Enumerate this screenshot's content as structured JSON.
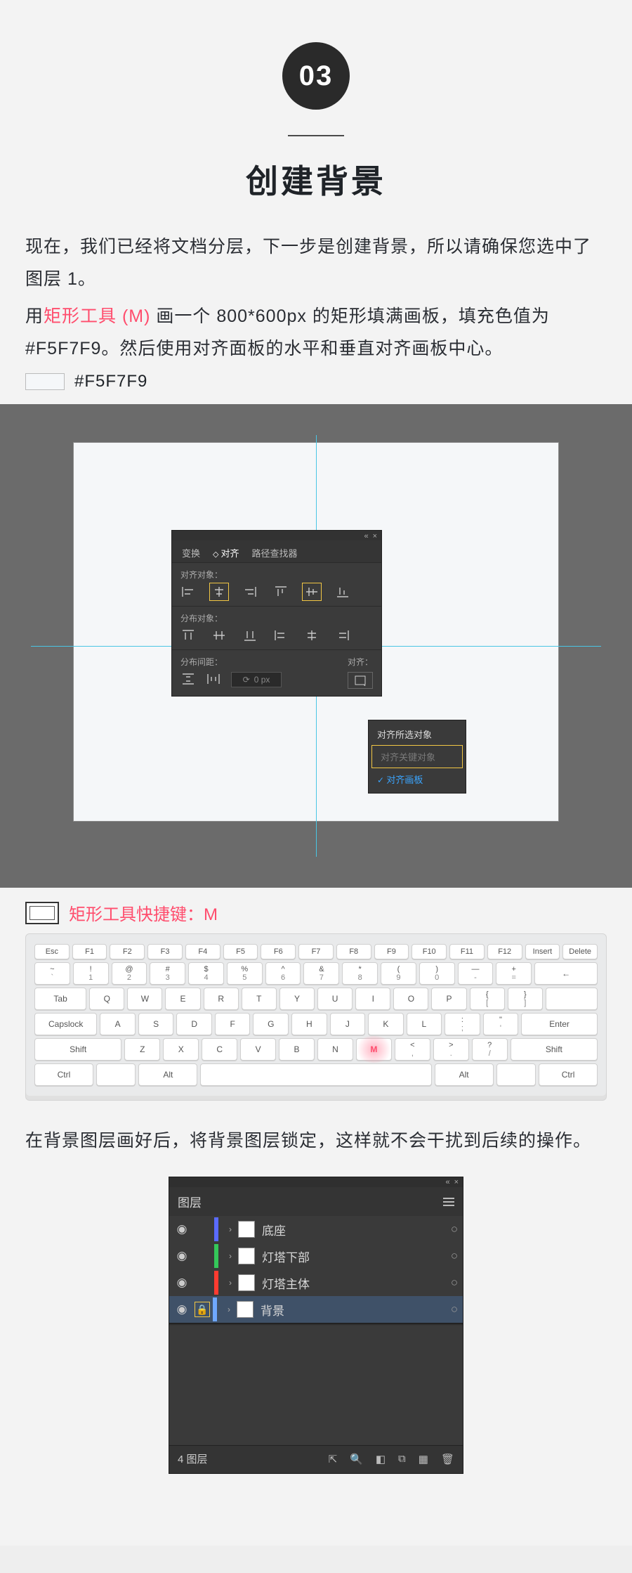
{
  "section": {
    "number": "03",
    "title": "创建背景",
    "intro_before": "现在，我们已经将文档分层，下一步是创建背景，所以请确保您选中了图层 1。",
    "intro2_a": "用",
    "intro2_tool": "矩形工具 (M) ",
    "intro2_b": "画一个 800*600px 的矩形填满画板，填充色值为 #F5F7F9。然后使用对齐面板的水平和垂直对齐画板中心。",
    "swatch_code": "#F5F7F9",
    "shortcut_label": "矩形工具快捷键：M",
    "outro": "在背景图层画好后，将背景图层锁定，这样就不会干扰到后续的操作。",
    "colors": {
      "accent": "#ff4d6d",
      "swatch": "#F5F7F9"
    }
  },
  "align_panel": {
    "tabs": [
      "变换",
      "对齐",
      "路径查找器"
    ],
    "group1": "对齐对象：",
    "group2": "分布对象：",
    "group3": "分布间距：",
    "align_to_label": "对齐：",
    "px_value": "0 px",
    "menu": {
      "opt1": "对齐所选对象",
      "opt2": "对齐关键对象",
      "opt3": "对齐画板"
    }
  },
  "keyboard": {
    "row_fn": [
      "Esc",
      "F1",
      "F2",
      "F3",
      "F4",
      "F5",
      "F6",
      "F7",
      "F8",
      "F9",
      "F10",
      "F11",
      "F12",
      "Insert",
      "Delete"
    ],
    "row_num": [
      {
        "u": "~",
        "l": "`"
      },
      {
        "u": "!",
        "l": "1"
      },
      {
        "u": "@",
        "l": "2"
      },
      {
        "u": "#",
        "l": "3"
      },
      {
        "u": "$",
        "l": "4"
      },
      {
        "u": "%",
        "l": "5"
      },
      {
        "u": "^",
        "l": "6"
      },
      {
        "u": "&",
        "l": "7"
      },
      {
        "u": "*",
        "l": "8"
      },
      {
        "u": "(",
        "l": "9"
      },
      {
        "u": ")",
        "l": "0"
      },
      {
        "u": "—",
        "l": "-"
      },
      {
        "u": "+",
        "l": "="
      }
    ],
    "backspace": "←",
    "tab": "Tab",
    "row_q": [
      "Q",
      "W",
      "E",
      "R",
      "T",
      "Y",
      "U",
      "I",
      "O",
      "P"
    ],
    "bracket_l": {
      "u": "{",
      "l": "["
    },
    "bracket_r": {
      "u": "}",
      "l": "]"
    },
    "caps": "Capslock",
    "row_a": [
      "A",
      "S",
      "D",
      "F",
      "G",
      "H",
      "J",
      "K",
      "L"
    ],
    "semi": {
      "u": ":",
      "l": ";"
    },
    "quote": {
      "u": "\"",
      "l": "'"
    },
    "enter": "Enter",
    "shift": "Shift",
    "row_z": [
      "Z",
      "X",
      "C",
      "V",
      "B",
      "N",
      "M"
    ],
    "lt": {
      "u": "<",
      "l": ","
    },
    "gt": {
      "u": ">",
      "l": "."
    },
    "qm": {
      "u": "?",
      "l": "/"
    },
    "ctrl": "Ctrl",
    "alt": "Alt"
  },
  "layers": {
    "title": "图层",
    "rows": [
      {
        "name": "底座",
        "color": "#5a6bff"
      },
      {
        "name": "灯塔下部",
        "color": "#34c759"
      },
      {
        "name": "灯塔主体",
        "color": "#ff3b30"
      },
      {
        "name": "背景",
        "color": "#6fa8ff",
        "selected": true,
        "locked": true
      }
    ],
    "footer": "4 图层"
  }
}
